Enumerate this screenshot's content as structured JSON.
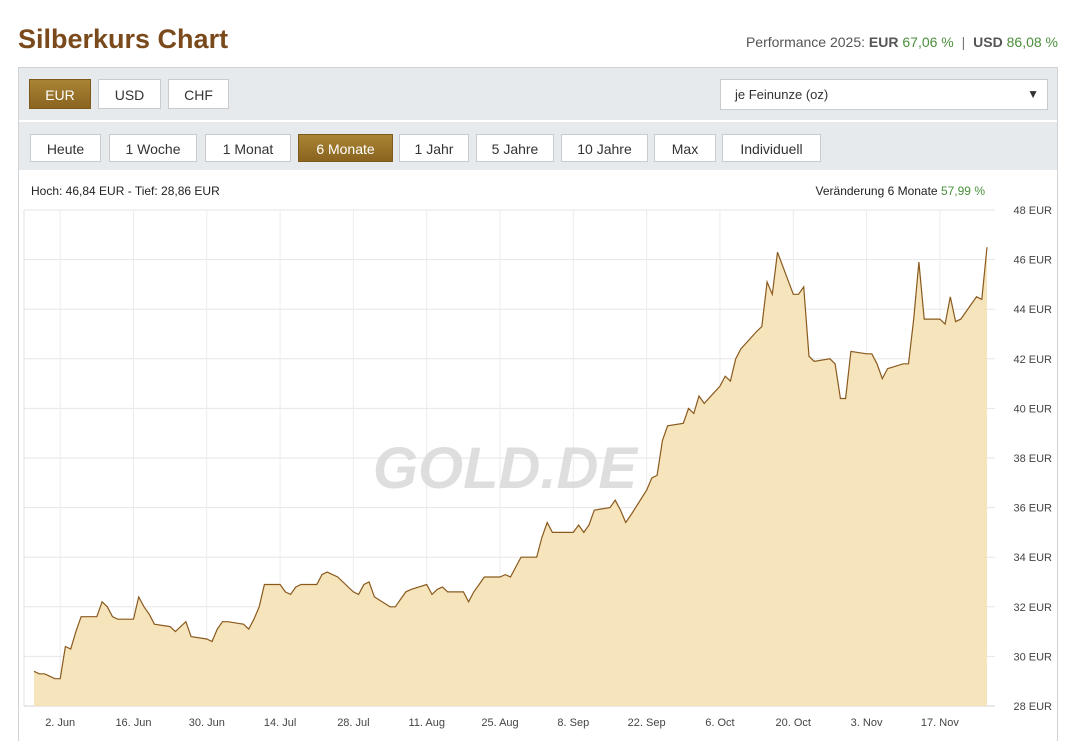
{
  "header": {
    "title": "Silberkurs Chart",
    "performance_label": "Performance 2025:",
    "perf_eur_label": "EUR",
    "perf_eur_value": "67,06 %",
    "perf_sep": "|",
    "perf_usd_label": "USD",
    "perf_usd_value": "86,08 %"
  },
  "currency_tabs": [
    {
      "label": "EUR",
      "active": true
    },
    {
      "label": "USD",
      "active": false
    },
    {
      "label": "CHF",
      "active": false
    }
  ],
  "unit_select": {
    "value": "je Feinunze (oz)"
  },
  "range_tabs": [
    {
      "label": "Heute",
      "active": false
    },
    {
      "label": "1 Woche",
      "active": false
    },
    {
      "label": "1 Monat",
      "active": false
    },
    {
      "label": "6 Monate",
      "active": true
    },
    {
      "label": "1 Jahr",
      "active": false
    },
    {
      "label": "5 Jahre",
      "active": false
    },
    {
      "label": "10 Jahre",
      "active": false
    },
    {
      "label": "Max",
      "active": false
    },
    {
      "label": "Individuell",
      "active": false
    }
  ],
  "stats": {
    "high_low": "Hoch: 46,84 EUR - Tief: 28,86 EUR",
    "change_label": "Veränderung 6 Monate",
    "change_value": "57,99 %"
  },
  "colors": {
    "accent": "#8a6420",
    "line": "#8a5a1e",
    "area": "#f5e4bc",
    "positive": "#4a8f3b"
  },
  "chart_data": {
    "type": "area",
    "x_ticks": [
      "2. Jun",
      "16. Jun",
      "30. Jun",
      "14. Jul",
      "28. Jul",
      "11. Aug",
      "25. Aug",
      "8. Sep",
      "22. Sep",
      "6. Oct",
      "20. Oct",
      "3. Nov",
      "17. Nov"
    ],
    "y_ticks": [
      "28 EUR",
      "30 EUR",
      "32 EUR",
      "34 EUR",
      "36 EUR",
      "38 EUR",
      "40 EUR",
      "42 EUR",
      "44 EUR",
      "46 EUR",
      "48 EUR"
    ],
    "ylim": [
      28,
      48
    ],
    "grid": true,
    "watermark": "GOLD.DE",
    "series": [
      {
        "points": [
          [
            "2025-05-28",
            29.4
          ],
          [
            "2025-05-29",
            29.3
          ],
          [
            "2025-05-30",
            29.3
          ],
          [
            "2025-05-31",
            29.2
          ],
          [
            "2025-06-01",
            29.1
          ],
          [
            "2025-06-02",
            29.1
          ],
          [
            "2025-06-03",
            30.4
          ],
          [
            "2025-06-04",
            30.3
          ],
          [
            "2025-06-05",
            31.0
          ],
          [
            "2025-06-06",
            31.6
          ],
          [
            "2025-06-09",
            31.6
          ],
          [
            "2025-06-10",
            32.2
          ],
          [
            "2025-06-11",
            32.0
          ],
          [
            "2025-06-12",
            31.6
          ],
          [
            "2025-06-13",
            31.5
          ],
          [
            "2025-06-16",
            31.5
          ],
          [
            "2025-06-17",
            32.4
          ],
          [
            "2025-06-18",
            32.0
          ],
          [
            "2025-06-19",
            31.7
          ],
          [
            "2025-06-20",
            31.3
          ],
          [
            "2025-06-23",
            31.2
          ],
          [
            "2025-06-24",
            31.0
          ],
          [
            "2025-06-25",
            31.2
          ],
          [
            "2025-06-26",
            31.4
          ],
          [
            "2025-06-27",
            30.8
          ],
          [
            "2025-06-30",
            30.7
          ],
          [
            "2025-07-01",
            30.6
          ],
          [
            "2025-07-02",
            31.1
          ],
          [
            "2025-07-03",
            31.4
          ],
          [
            "2025-07-04",
            31.4
          ],
          [
            "2025-07-07",
            31.3
          ],
          [
            "2025-07-08",
            31.1
          ],
          [
            "2025-07-09",
            31.5
          ],
          [
            "2025-07-10",
            32.0
          ],
          [
            "2025-07-11",
            32.9
          ],
          [
            "2025-07-14",
            32.9
          ],
          [
            "2025-07-15",
            32.6
          ],
          [
            "2025-07-16",
            32.5
          ],
          [
            "2025-07-17",
            32.8
          ],
          [
            "2025-07-18",
            32.9
          ],
          [
            "2025-07-21",
            32.9
          ],
          [
            "2025-07-22",
            33.3
          ],
          [
            "2025-07-23",
            33.4
          ],
          [
            "2025-07-24",
            33.3
          ],
          [
            "2025-07-25",
            33.2
          ],
          [
            "2025-07-28",
            32.6
          ],
          [
            "2025-07-29",
            32.5
          ],
          [
            "2025-07-30",
            32.9
          ],
          [
            "2025-07-31",
            33.0
          ],
          [
            "2025-08-01",
            32.4
          ],
          [
            "2025-08-04",
            32.0
          ],
          [
            "2025-08-05",
            32.0
          ],
          [
            "2025-08-06",
            32.3
          ],
          [
            "2025-08-07",
            32.6
          ],
          [
            "2025-08-08",
            32.7
          ],
          [
            "2025-08-11",
            32.9
          ],
          [
            "2025-08-12",
            32.5
          ],
          [
            "2025-08-13",
            32.7
          ],
          [
            "2025-08-14",
            32.8
          ],
          [
            "2025-08-15",
            32.6
          ],
          [
            "2025-08-18",
            32.6
          ],
          [
            "2025-08-19",
            32.2
          ],
          [
            "2025-08-20",
            32.6
          ],
          [
            "2025-08-21",
            32.9
          ],
          [
            "2025-08-22",
            33.2
          ],
          [
            "2025-08-25",
            33.2
          ],
          [
            "2025-08-26",
            33.3
          ],
          [
            "2025-08-27",
            33.2
          ],
          [
            "2025-08-28",
            33.6
          ],
          [
            "2025-08-29",
            34.0
          ],
          [
            "2025-09-01",
            34.0
          ],
          [
            "2025-09-02",
            34.8
          ],
          [
            "2025-09-03",
            35.4
          ],
          [
            "2025-09-04",
            35.0
          ],
          [
            "2025-09-05",
            35.0
          ],
          [
            "2025-09-08",
            35.0
          ],
          [
            "2025-09-09",
            35.3
          ],
          [
            "2025-09-10",
            35.0
          ],
          [
            "2025-09-11",
            35.3
          ],
          [
            "2025-09-12",
            35.9
          ],
          [
            "2025-09-15",
            36.0
          ],
          [
            "2025-09-16",
            36.3
          ],
          [
            "2025-09-17",
            35.9
          ],
          [
            "2025-09-18",
            35.4
          ],
          [
            "2025-09-19",
            35.7
          ],
          [
            "2025-09-22",
            36.7
          ],
          [
            "2025-09-23",
            37.2
          ],
          [
            "2025-09-24",
            37.3
          ],
          [
            "2025-09-25",
            38.7
          ],
          [
            "2025-09-26",
            39.3
          ],
          [
            "2025-09-29",
            39.4
          ],
          [
            "2025-09-30",
            40.0
          ],
          [
            "2025-10-01",
            39.8
          ],
          [
            "2025-10-02",
            40.5
          ],
          [
            "2025-10-03",
            40.2
          ],
          [
            "2025-10-06",
            40.9
          ],
          [
            "2025-10-07",
            41.3
          ],
          [
            "2025-10-08",
            41.1
          ],
          [
            "2025-10-09",
            42.0
          ],
          [
            "2025-10-10",
            42.4
          ],
          [
            "2025-10-13",
            43.1
          ],
          [
            "2025-10-14",
            43.3
          ],
          [
            "2025-10-15",
            45.1
          ],
          [
            "2025-10-16",
            44.6
          ],
          [
            "2025-10-17",
            46.3
          ],
          [
            "2025-10-20",
            44.6
          ],
          [
            "2025-10-21",
            44.6
          ],
          [
            "2025-10-22",
            44.9
          ],
          [
            "2025-10-23",
            42.1
          ],
          [
            "2025-10-24",
            41.9
          ],
          [
            "2025-10-27",
            42.0
          ],
          [
            "2025-10-28",
            41.8
          ],
          [
            "2025-10-29",
            40.4
          ],
          [
            "2025-10-30",
            40.4
          ],
          [
            "2025-10-31",
            42.3
          ],
          [
            "2025-11-03",
            42.2
          ],
          [
            "2025-11-04",
            42.2
          ],
          [
            "2025-11-05",
            41.8
          ],
          [
            "2025-11-06",
            41.2
          ],
          [
            "2025-11-07",
            41.6
          ],
          [
            "2025-11-10",
            41.8
          ],
          [
            "2025-11-11",
            41.8
          ],
          [
            "2025-11-12",
            43.6
          ],
          [
            "2025-11-13",
            45.9
          ],
          [
            "2025-11-14",
            43.6
          ],
          [
            "2025-11-17",
            43.6
          ],
          [
            "2025-11-18",
            43.4
          ],
          [
            "2025-11-19",
            44.5
          ],
          [
            "2025-11-20",
            43.5
          ],
          [
            "2025-11-21",
            43.6
          ],
          [
            "2025-11-24",
            44.5
          ],
          [
            "2025-11-25",
            44.4
          ],
          [
            "2025-11-26",
            46.5
          ]
        ]
      }
    ]
  }
}
